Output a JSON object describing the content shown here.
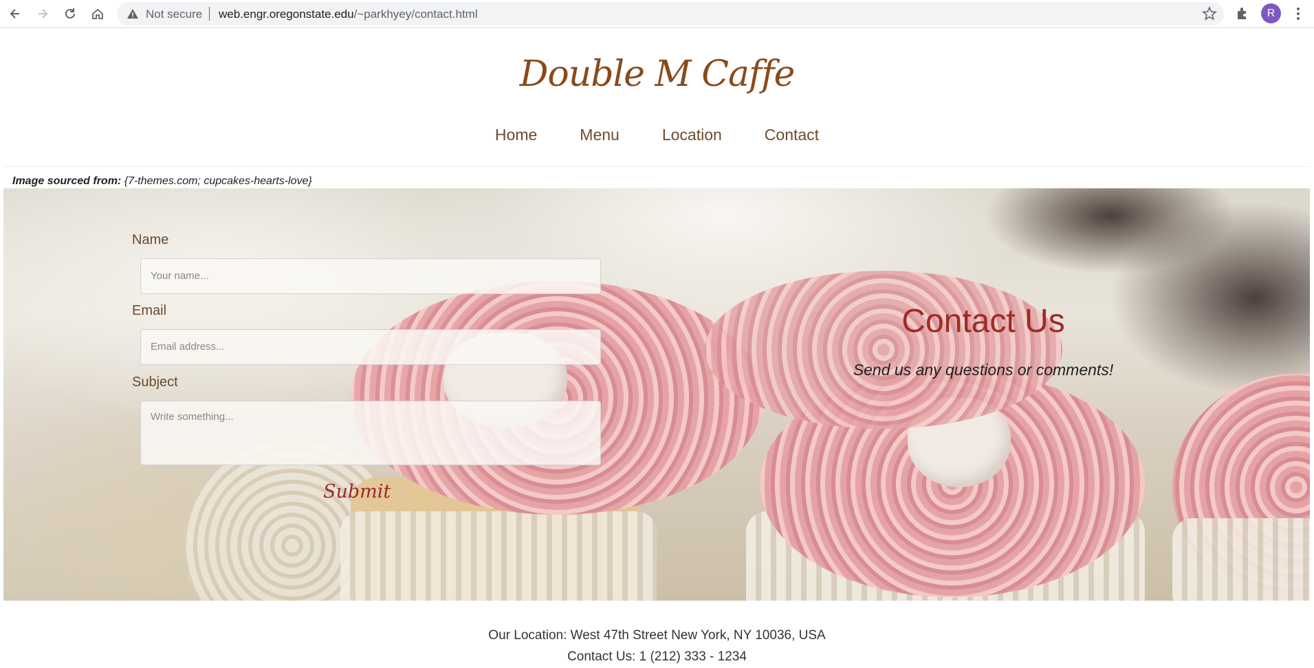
{
  "browser": {
    "security_label": "Not secure",
    "url_host": "web.engr.oregonstate.edu",
    "url_path": "/~parkhyey/contact.html",
    "profile_initial": "R",
    "icons": [
      "back-arrow-icon",
      "forward-arrow-icon",
      "reload-icon",
      "home-icon",
      "warning-icon",
      "star-icon",
      "extensions-icon",
      "kebab-menu-icon"
    ]
  },
  "site": {
    "title": "Double M Caffe",
    "nav": [
      "Home",
      "Menu",
      "Location",
      "Contact"
    ]
  },
  "credit": {
    "label": "Image sourced from:",
    "source": "{7-themes.com; cupcakes-hearts-love}"
  },
  "form": {
    "name_label": "Name",
    "name_placeholder": "Your name...",
    "email_label": "Email",
    "email_placeholder": "Email address...",
    "subject_label": "Subject",
    "subject_placeholder": "Write something...",
    "submit_label": "Submit"
  },
  "contact": {
    "title": "Contact Us",
    "subtitle": "Send us any questions or comments!"
  },
  "footer": {
    "location": "Our Location: West 47th Street New York, NY 10036, USA",
    "phone": "Contact Us: 1 (212) 333 - 1234"
  },
  "colors": {
    "brand": "#8a4a1c",
    "accent": "#a02a24",
    "nav_text": "#6b4a2e"
  }
}
